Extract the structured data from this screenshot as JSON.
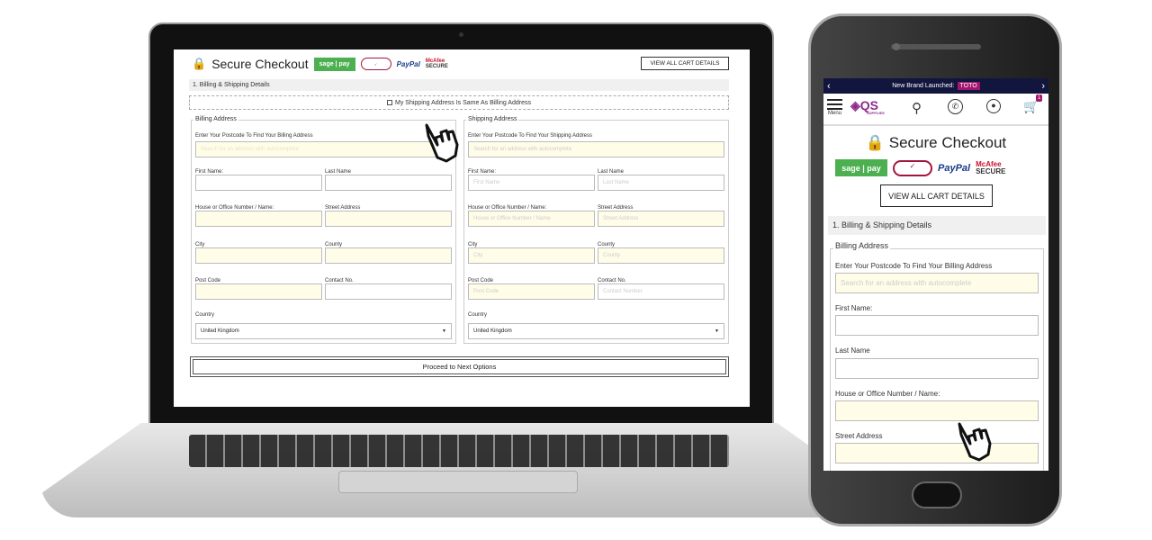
{
  "checkout": {
    "title": "Secure Checkout",
    "logos": {
      "sagepay": "sage | pay",
      "verified": "Verified Secured",
      "paypal": "PayPal",
      "mcafee": "McAfee",
      "mcafee_sub": "SECURE"
    },
    "view_cart": "VIEW ALL CART DETAILS",
    "section": "1. Billing & Shipping Details",
    "same_address": "My Shipping Address Is Same As Billing Address",
    "billing": {
      "legend": "Billing Address",
      "postcode_label": "Enter Your Postcode To Find Your Billing Address",
      "search_placeholder": "Search for an address with autocomplete"
    },
    "shipping": {
      "legend": "Shipping Address",
      "postcode_label": "Enter Your Postcode To Find Your Shipping Address",
      "search_placeholder": "Search for an address with autocomplete"
    },
    "labels": {
      "first": "First Name:",
      "last": "Last Name",
      "house": "House or Office Number / Name:",
      "street": "Street Address",
      "city": "City",
      "county": "County",
      "post": "Post Code",
      "contact": "Contact No.",
      "country": "Country"
    },
    "placeholders": {
      "first": "First Name",
      "last": "Last Name",
      "house": "House or Office Number / Name",
      "street": "Street Address",
      "city": "City",
      "county": "County",
      "post": "Post Code",
      "contact": "Contact Number"
    },
    "country_value": "United Kingdom",
    "proceed": "Proceed to Next Options"
  },
  "mobile": {
    "banner": "New Brand Launched:",
    "banner_badge": "TOTO",
    "menu": "Menu",
    "brand": "QS",
    "brand_sub": "SUPPLIES",
    "cart_count": "1",
    "colors": {
      "banner": "#12153d",
      "badge": "#a3166e",
      "brand": "#8e2a8b"
    }
  }
}
